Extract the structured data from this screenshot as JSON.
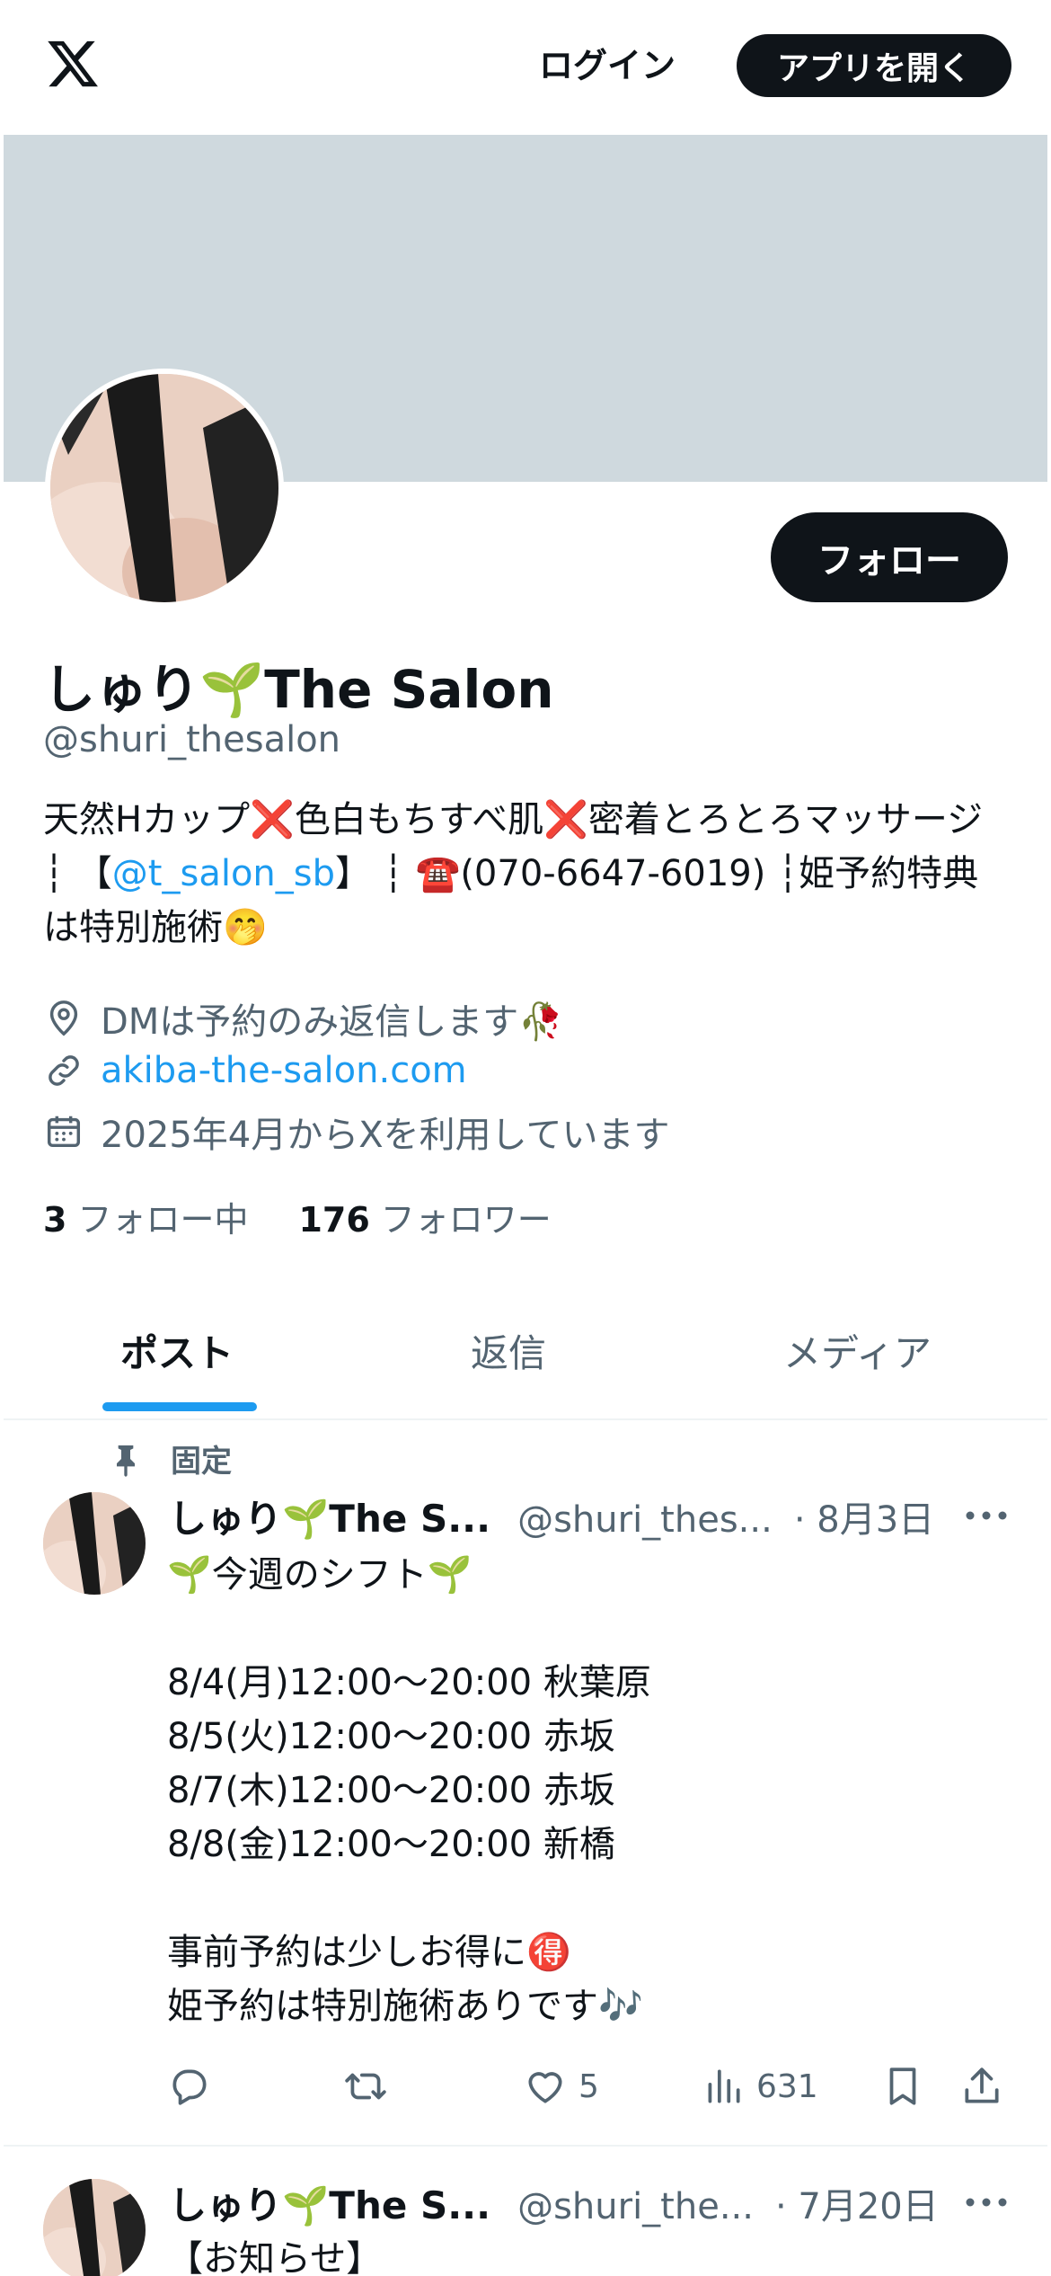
{
  "topbar": {
    "login_label": "ログイン",
    "open_app_label": "アプリを開く"
  },
  "profile": {
    "follow_label": "フォロー",
    "name": "しゅり🌱The Salon",
    "handle": "@shuri_thesalon",
    "bio_part1": "天然Hカップ❌色白もちすべ肌❌密着とろとろマッサージ ┆ 【",
    "bio_link": "@t_salon_sb",
    "bio_part2": "】 ┆ ☎️(070-6647-6019) ┆姫予約特典は特別施術🤭",
    "location": "DMは予約のみ返信します🥀",
    "website": "akiba-the-salon.com",
    "joined": "2025年4月からXを利用しています",
    "following_count": "3",
    "following_label": "フォロー中",
    "followers_count": "176",
    "followers_label": "フォロワー"
  },
  "tabs": [
    {
      "label": "ポスト"
    },
    {
      "label": "返信"
    },
    {
      "label": "メディア"
    }
  ],
  "posts": [
    {
      "pinned_label": "固定",
      "name": "しゅり🌱The S...",
      "handle": "@shuri_thes...",
      "date": "· 8月3日",
      "body": "🌱今週のシフト🌱\n\n8/4(月)12:00〜20:00 秋葉原\n8/5(火)12:00〜20:00 赤坂\n8/7(木)12:00〜20:00 赤坂\n8/8(金)12:00〜20:00 新橋\n\n事前予約は少しお得に🉐\n姫予約は特別施術ありです🎶",
      "likes": "5",
      "views": "631"
    },
    {
      "name": "しゅり🌱The S...",
      "handle": "@shuri_the...",
      "date": "· 7月20日",
      "body_first_line": "【お知らせ】"
    }
  ],
  "colors": {
    "accent": "#1d9bf0",
    "text": "#0f1419",
    "muted": "#536471",
    "banner": "#cfd9de"
  },
  "icons": [
    "x-logo-icon",
    "location-icon",
    "link-icon",
    "calendar-icon",
    "pin-icon",
    "reply-icon",
    "repost-icon",
    "like-icon",
    "views-icon",
    "bookmark-icon",
    "share-icon",
    "more-icon"
  ]
}
